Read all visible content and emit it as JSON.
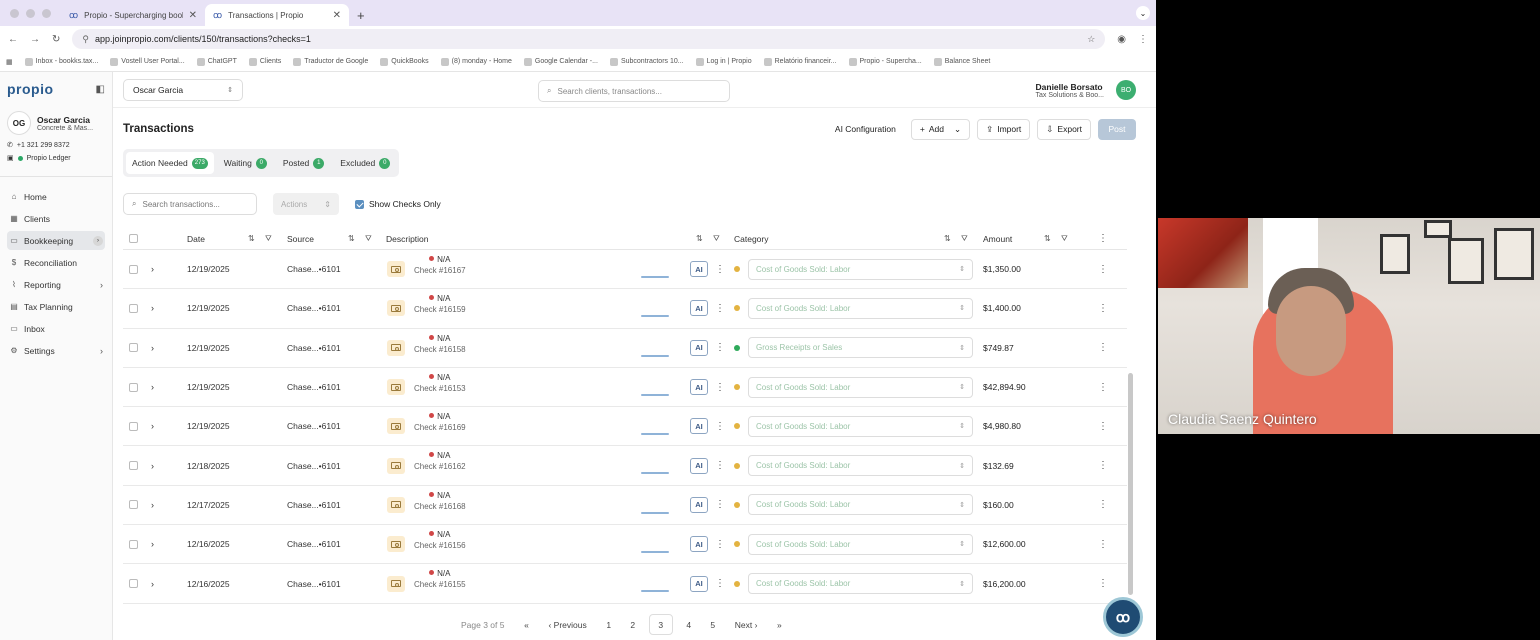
{
  "browser": {
    "tabs": [
      {
        "label": "Propio - Supercharging book",
        "active": false
      },
      {
        "label": "Transactions | Propio",
        "active": true
      }
    ],
    "url": "app.joinpropio.com/clients/150/transactions?checks=1",
    "bookmarks": [
      "Inbox - bookks.tax...",
      "Vostell User Portal...",
      "ChatGPT",
      "Clients",
      "Traductor de Google",
      "QuickBooks",
      "(8) monday - Home",
      "Google Calendar -...",
      "Subcontractors 10...",
      "Log in | Propio",
      "Relatório financeir...",
      "Propio - Supercha...",
      "Balance Sheet"
    ]
  },
  "sidebar": {
    "logo": "propio",
    "client": {
      "initials": "OG",
      "name": "Oscar Garcia",
      "company": "Concrete & Mas..."
    },
    "phone": "+1 321 299 8372",
    "ledger": "Propio Ledger",
    "nav": [
      {
        "label": "Home",
        "icon": "home-icon",
        "glyph": "⌂",
        "chevron": false,
        "active": false
      },
      {
        "label": "Clients",
        "icon": "grid-icon",
        "glyph": "▦",
        "chevron": false,
        "active": false
      },
      {
        "label": "Bookkeeping",
        "icon": "book-icon",
        "glyph": "▭",
        "chevron": false,
        "active": true
      },
      {
        "label": "Reconciliation",
        "icon": "dollar-icon",
        "glyph": "$",
        "chevron": false,
        "active": false
      },
      {
        "label": "Reporting",
        "icon": "chart-icon",
        "glyph": "⌇",
        "chevron": true,
        "active": false
      },
      {
        "label": "Tax Planning",
        "icon": "calculator-icon",
        "glyph": "▤",
        "chevron": false,
        "active": false
      },
      {
        "label": "Inbox",
        "icon": "inbox-icon",
        "glyph": "▭",
        "chevron": false,
        "active": false
      },
      {
        "label": "Settings",
        "icon": "gear-icon",
        "glyph": "⚙",
        "chevron": true,
        "active": false
      }
    ]
  },
  "topbar": {
    "client_select": "Oscar Garcia",
    "search_placeholder": "Search clients, transactions...",
    "user_name": "Danielle Borsato",
    "user_org": "Tax Solutions & Boo...",
    "user_initials": "BO"
  },
  "page": {
    "title": "Transactions",
    "ai_config": "AI Configuration",
    "add": "Add",
    "import": "Import",
    "export": "Export",
    "post": "Post"
  },
  "status_tabs": [
    {
      "label": "Action Needed",
      "count": "273",
      "active": true
    },
    {
      "label": "Waiting",
      "count": "0",
      "active": false
    },
    {
      "label": "Posted",
      "count": "1",
      "active": false
    },
    {
      "label": "Excluded",
      "count": "0",
      "active": false
    }
  ],
  "filters": {
    "search_placeholder": "Search transactions...",
    "actions": "Actions",
    "show_checks": "Show Checks Only",
    "show_checks_checked": true
  },
  "columns": {
    "date": "Date",
    "source": "Source",
    "description": "Description",
    "category": "Category",
    "amount": "Amount"
  },
  "rows": [
    {
      "date": "12/19/2025",
      "source": "Chase...•6101",
      "payee": "N/A",
      "check": "Check #16167",
      "category": "Cost of Goods Sold: Labor",
      "cat_color": "#e3b341",
      "amount": "$1,350.00"
    },
    {
      "date": "12/19/2025",
      "source": "Chase...•6101",
      "payee": "N/A",
      "check": "Check #16159",
      "category": "Cost of Goods Sold: Labor",
      "cat_color": "#e3b341",
      "amount": "$1,400.00"
    },
    {
      "date": "12/19/2025",
      "source": "Chase...•6101",
      "payee": "N/A",
      "check": "Check #16158",
      "category": "Gross Receipts or Sales",
      "cat_color": "#2faa5b",
      "amount": "$749.87"
    },
    {
      "date": "12/19/2025",
      "source": "Chase...•6101",
      "payee": "N/A",
      "check": "Check #16153",
      "category": "Cost of Goods Sold: Labor",
      "cat_color": "#e3b341",
      "amount": "$42,894.90"
    },
    {
      "date": "12/19/2025",
      "source": "Chase...•6101",
      "payee": "N/A",
      "check": "Check #16169",
      "category": "Cost of Goods Sold: Labor",
      "cat_color": "#e3b341",
      "amount": "$4,980.80"
    },
    {
      "date": "12/18/2025",
      "source": "Chase...•6101",
      "payee": "N/A",
      "check": "Check #16162",
      "category": "Cost of Goods Sold: Labor",
      "cat_color": "#e3b341",
      "amount": "$132.69"
    },
    {
      "date": "12/17/2025",
      "source": "Chase...•6101",
      "payee": "N/A",
      "check": "Check #16168",
      "category": "Cost of Goods Sold: Labor",
      "cat_color": "#e3b341",
      "amount": "$160.00"
    },
    {
      "date": "12/16/2025",
      "source": "Chase...•6101",
      "payee": "N/A",
      "check": "Check #16156",
      "category": "Cost of Goods Sold: Labor",
      "cat_color": "#e3b341",
      "amount": "$12,600.00"
    },
    {
      "date": "12/16/2025",
      "source": "Chase...•6101",
      "payee": "N/A",
      "check": "Check #16155",
      "category": "Cost of Goods Sold: Labor",
      "cat_color": "#e3b341",
      "amount": "$16,200.00"
    }
  ],
  "pagination": {
    "label": "Page 3 of 5",
    "first": "«",
    "previous": "‹ Previous",
    "pages": [
      "1",
      "2",
      "3",
      "4",
      "5"
    ],
    "current": "3",
    "next": "Next ›",
    "last": "»"
  },
  "video": {
    "participant": "Claudia Saenz Quintero"
  }
}
